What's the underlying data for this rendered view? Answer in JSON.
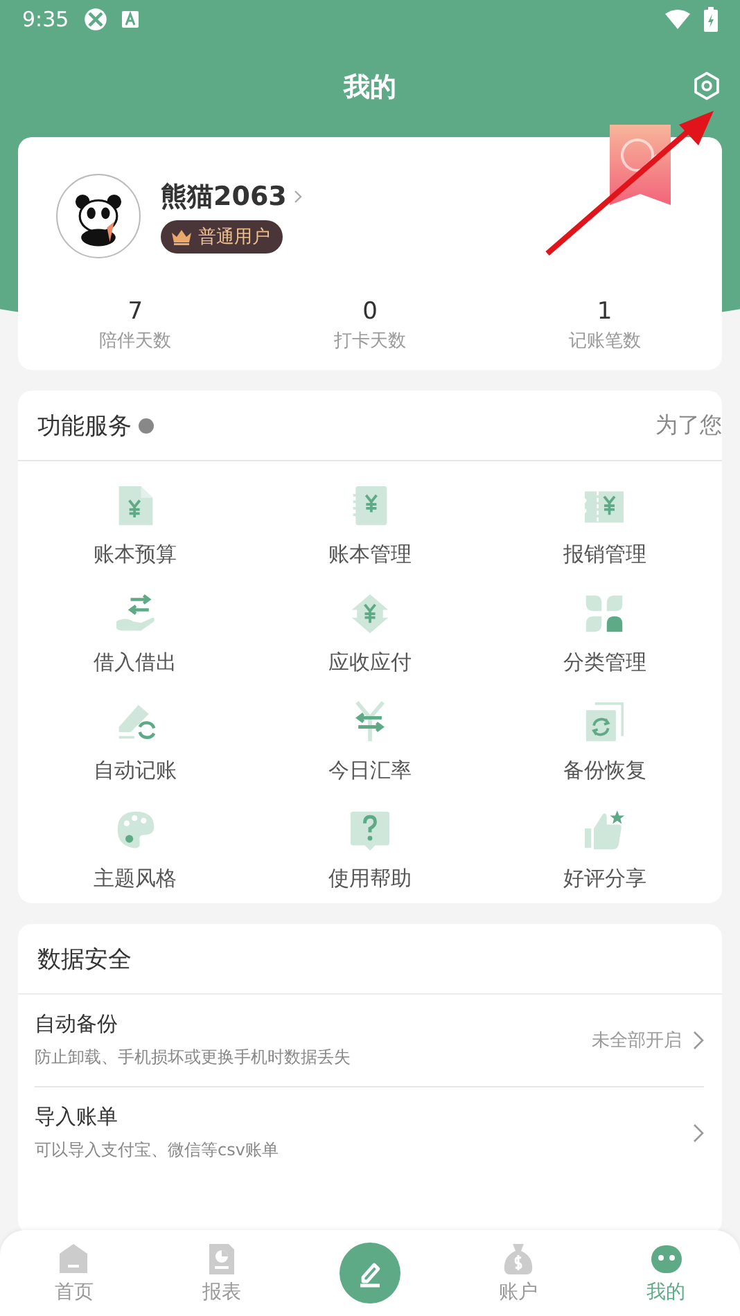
{
  "status_bar": {
    "time": "9:35"
  },
  "header": {
    "title": "我的"
  },
  "profile": {
    "name": "熊猫2063",
    "badge": "普通用户",
    "stats": [
      {
        "value": "7",
        "label": "陪伴天数"
      },
      {
        "value": "0",
        "label": "打卡天数"
      },
      {
        "value": "1",
        "label": "记账笔数"
      }
    ]
  },
  "services": {
    "title": "功能服务",
    "notice": "为了您",
    "items": [
      {
        "kind": "budget",
        "label": "账本预算"
      },
      {
        "kind": "ledger",
        "label": "账本管理"
      },
      {
        "kind": "reimburse",
        "label": "报销管理"
      },
      {
        "kind": "lend",
        "label": "借入借出"
      },
      {
        "kind": "receivable",
        "label": "应收应付"
      },
      {
        "kind": "category",
        "label": "分类管理"
      },
      {
        "kind": "auto",
        "label": "自动记账"
      },
      {
        "kind": "rate",
        "label": "今日汇率"
      },
      {
        "kind": "backup",
        "label": "备份恢复"
      },
      {
        "kind": "theme",
        "label": "主题风格"
      },
      {
        "kind": "help",
        "label": "使用帮助"
      },
      {
        "kind": "rate_share",
        "label": "好评分享"
      }
    ]
  },
  "data_security": {
    "title": "数据安全",
    "rows": [
      {
        "title": "自动备份",
        "subtitle": "防止卸载、手机损坏或更换手机时数据丢失",
        "value": "未全部开启"
      },
      {
        "title": "导入账单",
        "subtitle": "可以导入支付宝、微信等csv账单"
      }
    ]
  },
  "bottom_nav": [
    {
      "kind": "home",
      "label": "首页",
      "selected": false
    },
    {
      "kind": "report",
      "label": "报表",
      "selected": false
    },
    {
      "kind": "add"
    },
    {
      "kind": "account",
      "label": "账户",
      "selected": false
    },
    {
      "kind": "mine",
      "label": "我的",
      "selected": true
    }
  ]
}
